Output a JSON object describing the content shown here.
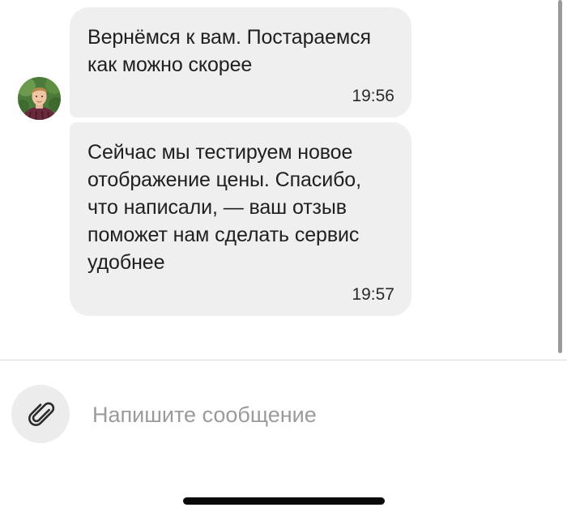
{
  "messages": [
    {
      "text": "Вернёмся к вам. Постараемся\nкак можно скорее",
      "time": "19:56"
    },
    {
      "text": "Сейчас мы тестируем новое\nотображение цены. Спасибо,\nчто написали, — ваш отзыв\nпоможет нам сделать сервис\nудобнее",
      "time": "19:57"
    }
  ],
  "composer": {
    "placeholder": "Напишите сообщение",
    "attach_icon": "paperclip-icon"
  },
  "colors": {
    "bubble": "#efefef",
    "attach_bg": "#ececec",
    "placeholder": "#9b9b9b"
  }
}
